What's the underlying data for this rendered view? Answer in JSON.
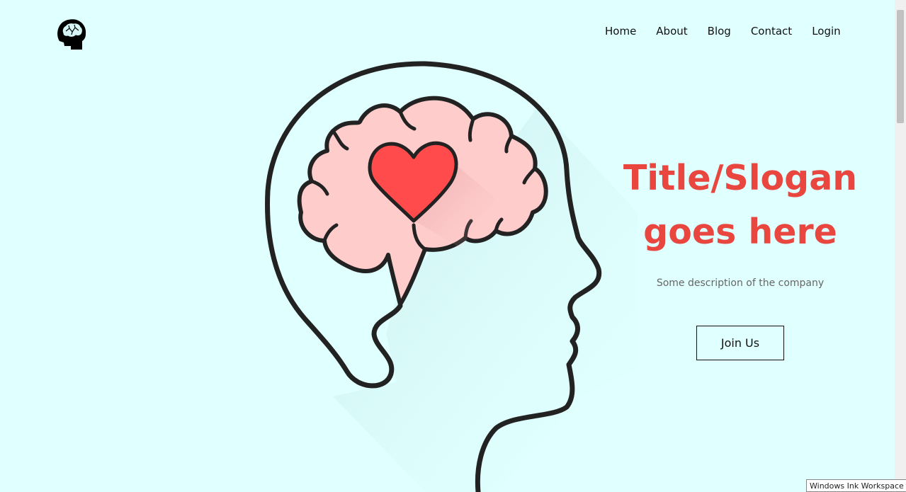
{
  "nav": {
    "items": [
      {
        "label": "Home"
      },
      {
        "label": "About"
      },
      {
        "label": "Blog"
      },
      {
        "label": "Contact"
      },
      {
        "label": "Login"
      }
    ]
  },
  "hero": {
    "title_line1": "Title/Slogan",
    "title_line2": "goes here",
    "description": "Some description of the company",
    "cta_label": "Join Us"
  },
  "tooltip": {
    "text": "Windows Ink Workspace"
  },
  "colors": {
    "background": "#e0ffff",
    "accent": "#e8463f",
    "brain": "#ffcccc",
    "heart": "#ff4b4b"
  },
  "icons": {
    "logo": "head-brain-icon",
    "hero": "head-with-brain-and-heart-illustration"
  }
}
